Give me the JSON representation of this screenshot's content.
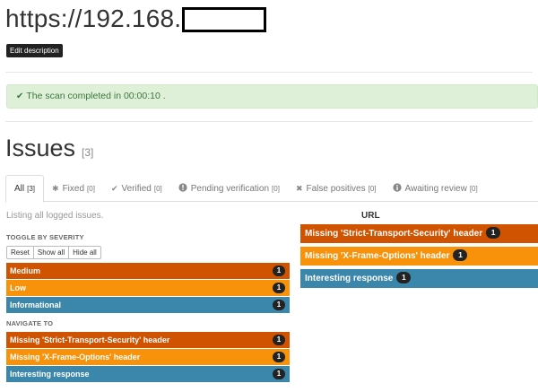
{
  "header": {
    "title": "https://192.168.",
    "edit_label": "Edit description"
  },
  "alert": {
    "message": "The scan completed in 00:00:10 ."
  },
  "issues": {
    "heading": "Issues",
    "count": "[3]"
  },
  "tabs": [
    {
      "label": "All",
      "count": "[3]",
      "icon": "none"
    },
    {
      "label": "Fixed",
      "count": "[0]",
      "icon": "asterisk-icon"
    },
    {
      "label": "Verified",
      "count": "[0]",
      "icon": "check-icon"
    },
    {
      "label": "Pending verification",
      "count": "[0]",
      "icon": "exclamation-circle-icon"
    },
    {
      "label": "False positives",
      "count": "[0]",
      "icon": "times-icon"
    },
    {
      "label": "Awaiting review",
      "count": "[0]",
      "icon": "info-circle-icon"
    }
  ],
  "left": {
    "listing_text": "Listing all logged issues.",
    "toggle_label": "TOGGLE BY SEVERITY",
    "toggle_buttons": {
      "reset": "Reset",
      "show_all": "Show all",
      "hide_all": "Hide all"
    },
    "severities": [
      {
        "label": "Medium",
        "count": "1",
        "color": "#cf5300"
      },
      {
        "label": "Low",
        "count": "1",
        "color": "#f7920a"
      },
      {
        "label": "Informational",
        "count": "1",
        "color": "#3b86ab"
      }
    ],
    "navigate_label": "NAVIGATE TO",
    "navigate": [
      {
        "label": "Missing 'Strict-Transport-Security' header",
        "count": "1"
      },
      {
        "label": "Missing 'X-Frame-Options' header",
        "count": "1"
      },
      {
        "label": "Interesting response",
        "count": "1"
      }
    ]
  },
  "right": {
    "url_heading": "URL",
    "issues": [
      {
        "label": "Missing 'Strict-Transport-Security' header",
        "count": "1"
      },
      {
        "label": "Missing 'X-Frame-Options' header",
        "count": "1"
      },
      {
        "label": "Interesting response",
        "count": "1"
      }
    ]
  }
}
